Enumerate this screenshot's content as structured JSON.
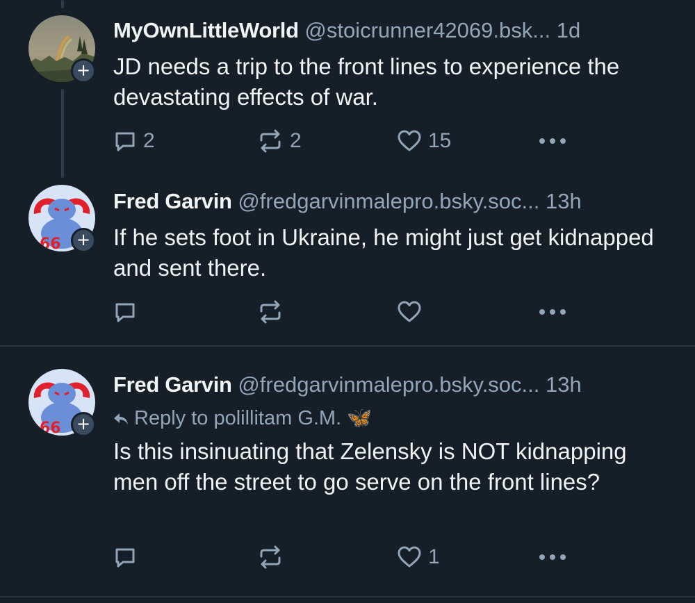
{
  "posts": [
    {
      "display_name": "MyOwnLittleWorld",
      "handle": "@stoicrunner42069.bsk...",
      "time": "1d",
      "text": "JD needs a trip to the front lines to experience the devastating effects of war.",
      "reply_count": "2",
      "repost_count": "2",
      "like_count": "15",
      "avatar_icon": "landscape-rainbow-avatar"
    },
    {
      "display_name": "Fred Garvin",
      "handle": "@fredgarvinmalepro.bsky.soc...",
      "time": "13h",
      "text": "If he sets foot in Ukraine, he might just get kidnapped and sent there.",
      "reply_count": "",
      "repost_count": "",
      "like_count": "",
      "avatar_icon": "devil-666-avatar",
      "avatar_text": "66"
    },
    {
      "display_name": "Fred Garvin",
      "handle": "@fredgarvinmalepro.bsky.soc...",
      "time": "13h",
      "reply_to": "Reply to polillitam G.M. 🦋",
      "text": "Is this insinuating that Zelensky is NOT kidnapping men off the street to go serve on the front lines?",
      "reply_count": "",
      "repost_count": "",
      "like_count": "1",
      "avatar_icon": "devil-666-avatar",
      "avatar_text": "66"
    }
  ],
  "follow_badge_symbol": "+",
  "colors": {
    "background": "#161e27",
    "text": "#f1f3f5",
    "muted": "#93a5b7",
    "divider": "#2a3440",
    "devil_red": "#e0202a",
    "devil_blue": "#6a8fd8"
  }
}
